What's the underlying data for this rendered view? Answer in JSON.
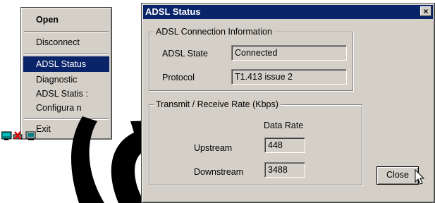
{
  "context_menu": {
    "items": [
      {
        "label": "Open"
      },
      {
        "label": "Disconnect"
      },
      {
        "label": "ADSL Status"
      },
      {
        "label": "Diagnostic"
      },
      {
        "label": "ADSL Statis  :"
      },
      {
        "label": "Configura    n"
      },
      {
        "label": "Exit"
      }
    ],
    "selected_color": "#0a246a"
  },
  "window": {
    "title": "ADSL Status",
    "close_glyph": "×",
    "connection_group": {
      "title": "ADSL Connection Information",
      "state_label": "ADSL State",
      "state_value": "Connected",
      "protocol_label": "Protocol",
      "protocol_value": "T1.413 issue 2"
    },
    "rate_group": {
      "title": "Transmit / Receive Rate  (Kbps)",
      "column_header": "Data Rate",
      "upstream_label": "Upstream",
      "upstream_value": "448",
      "downstream_label": "Downstream",
      "downstream_value": "3488"
    },
    "close_button_label": "Close"
  },
  "icons": [
    "network-tray-icon",
    "disconnected-x-icon",
    "computer-tray-icon",
    "curved-arrow-icon",
    "mouse-cursor-icon"
  ]
}
